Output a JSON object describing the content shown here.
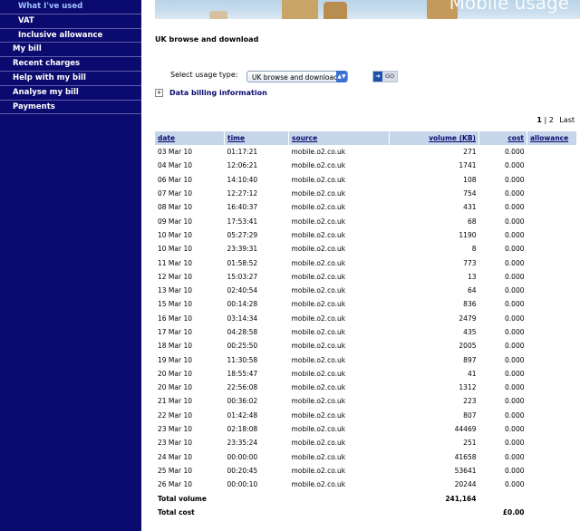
{
  "sidebar": {
    "items": [
      {
        "label": "What I've used",
        "sub": true,
        "active": true
      },
      {
        "label": "VAT",
        "sub": true
      },
      {
        "label": "Inclusive allowance",
        "sub": true
      },
      {
        "label": "My bill"
      },
      {
        "label": "Recent charges"
      },
      {
        "label": "Help with my bill"
      },
      {
        "label": "Analyse my bill"
      },
      {
        "label": "Payments"
      }
    ]
  },
  "banner": {
    "title": "Mobile usage"
  },
  "section_title": "UK browse and download",
  "filter": {
    "label": "Select usage type:",
    "selected": "UK browse and download",
    "go_label": "GO"
  },
  "billing_info": "Data billing information",
  "pager": {
    "current": "1",
    "other": "2",
    "last": "Last"
  },
  "table": {
    "headers": {
      "date": "date",
      "time": "time",
      "source": "source",
      "volume": "volume (KB)",
      "cost": "cost",
      "allowance": "allowance"
    },
    "rows": [
      [
        "03 Mar 10",
        "01:17:21",
        "mobile.o2.co.uk",
        "271",
        "0.000"
      ],
      [
        "04 Mar 10",
        "12:06:21",
        "mobile.o2.co.uk",
        "1741",
        "0.000"
      ],
      [
        "06 Mar 10",
        "14:10:40",
        "mobile.o2.co.uk",
        "108",
        "0.000"
      ],
      [
        "07 Mar 10",
        "12:27:12",
        "mobile.o2.co.uk",
        "754",
        "0.000"
      ],
      [
        "08 Mar 10",
        "16:40:37",
        "mobile.o2.co.uk",
        "431",
        "0.000"
      ],
      [
        "09 Mar 10",
        "17:53:41",
        "mobile.o2.co.uk",
        "68",
        "0.000"
      ],
      [
        "10 Mar 10",
        "05:27:29",
        "mobile.o2.co.uk",
        "1190",
        "0.000"
      ],
      [
        "10 Mar 10",
        "23:39:31",
        "mobile.o2.co.uk",
        "8",
        "0.000"
      ],
      [
        "11 Mar 10",
        "01:58:52",
        "mobile.o2.co.uk",
        "773",
        "0.000"
      ],
      [
        "12 Mar 10",
        "15:03:27",
        "mobile.o2.co.uk",
        "13",
        "0.000"
      ],
      [
        "13 Mar 10",
        "02:40:54",
        "mobile.o2.co.uk",
        "64",
        "0.000"
      ],
      [
        "15 Mar 10",
        "00:14:28",
        "mobile.o2.co.uk",
        "836",
        "0.000"
      ],
      [
        "16 Mar 10",
        "03:14:34",
        "mobile.o2.co.uk",
        "2479",
        "0.000"
      ],
      [
        "17 Mar 10",
        "04:28:58",
        "mobile.o2.co.uk",
        "435",
        "0.000"
      ],
      [
        "18 Mar 10",
        "00:25:50",
        "mobile.o2.co.uk",
        "2005",
        "0.000"
      ],
      [
        "19 Mar 10",
        "11:30:58",
        "mobile.o2.co.uk",
        "897",
        "0.000"
      ],
      [
        "20 Mar 10",
        "18:55:47",
        "mobile.o2.co.uk",
        "41",
        "0.000"
      ],
      [
        "20 Mar 10",
        "22:56:08",
        "mobile.o2.co.uk",
        "1312",
        "0.000"
      ],
      [
        "21 Mar 10",
        "00:36:02",
        "mobile.o2.co.uk",
        "223",
        "0.000"
      ],
      [
        "22 Mar 10",
        "01:42:48",
        "mobile.o2.co.uk",
        "807",
        "0.000"
      ],
      [
        "23 Mar 10",
        "02:18:08",
        "mobile.o2.co.uk",
        "44469",
        "0.000"
      ],
      [
        "23 Mar 10",
        "23:35:24",
        "mobile.o2.co.uk",
        "251",
        "0.000"
      ],
      [
        "24 Mar 10",
        "00:00:00",
        "mobile.o2.co.uk",
        "41658",
        "0.000"
      ],
      [
        "25 Mar 10",
        "00:20:45",
        "mobile.o2.co.uk",
        "53641",
        "0.000"
      ],
      [
        "26 Mar 10",
        "00:00:10",
        "mobile.o2.co.uk",
        "20244",
        "0.000"
      ]
    ],
    "total_volume_label": "Total volume",
    "total_volume": "241,164",
    "total_cost_label": "Total cost",
    "total_cost": "£0.00"
  },
  "colors": {
    "sidebar": "#0b0a6e",
    "header_row": "#c6d6ea",
    "link": "#0b0a6e"
  }
}
